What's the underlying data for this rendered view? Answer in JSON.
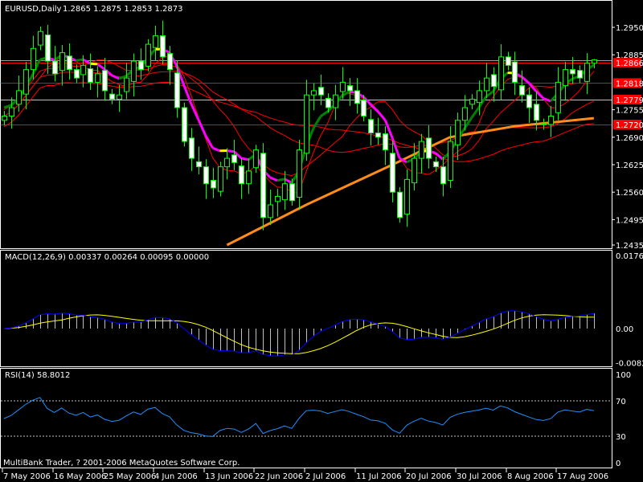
{
  "header": {
    "symbol_tf": "EURUSD,Daily",
    "ohlc": "1.2865 1.2875 1.2853 1.2873"
  },
  "macd_header": {
    "label": "MACD(12,26,9) 0.00337 0.00264 0.00095 0.00000"
  },
  "rsi_header": {
    "label": "RSI(14) 58.8012"
  },
  "copyright": "MultiBank Trader, ? 2001-2006 MetaQuotes Software Corp.",
  "colors": {
    "bull": "#00ff00",
    "bear_body": "#ffffff",
    "ma_up": "#008000",
    "ma_down": "#ff00ff",
    "ma_flat": "#ffff00",
    "ma_red": "#ff0000",
    "ma_orange": "#ff8c1a",
    "macd": "#0000ff",
    "signal": "#ffff00",
    "hist": "#c0c0c0",
    "rsi": "#1e90ff",
    "level_line": "#ff0000",
    "price_line": "#a0a0a0"
  },
  "chart_data": [
    {
      "type": "candlestick",
      "title": "EURUSD,Daily",
      "last_bar": {
        "open": 1.2865,
        "high": 1.2875,
        "low": 1.2853,
        "close": 1.2873
      },
      "ylim": [
        1.2435,
        1.296
      ],
      "y_ticks": [
        "1.2950",
        "1.2885",
        "1.2755",
        "1.2690",
        "1.2625",
        "1.2560",
        "1.2495",
        "1.2435"
      ],
      "y_tick_values": [
        1.295,
        1.2885,
        1.2755,
        1.269,
        1.2625,
        1.256,
        1.2495,
        1.2435
      ],
      "levels": [
        {
          "label": "1.2866",
          "value": 1.2866
        },
        {
          "label": "1.2818",
          "value": 1.2818
        },
        {
          "label": "1.2779",
          "value": 1.2779
        },
        {
          "label": "1.2720",
          "value": 1.272
        }
      ],
      "current_price": 1.2873,
      "close": [
        1.274,
        1.276,
        1.28,
        1.285,
        1.29,
        1.294,
        1.287,
        1.284,
        1.289,
        1.285,
        1.283,
        1.286,
        1.282,
        1.284,
        1.28,
        1.278,
        1.279,
        1.283,
        1.287,
        1.285,
        1.291,
        1.293,
        1.288,
        1.285,
        1.276,
        1.268,
        1.264,
        1.262,
        1.258,
        1.257,
        1.262,
        1.264,
        1.263,
        1.258,
        1.261,
        1.266,
        1.25,
        1.253,
        1.255,
        1.258,
        1.254,
        1.266,
        1.279,
        1.28,
        1.279,
        1.276,
        1.279,
        1.282,
        1.28,
        1.277,
        1.274,
        1.27,
        1.269,
        1.266,
        1.256,
        1.25,
        1.259,
        1.264,
        1.268,
        1.264,
        1.262,
        1.258,
        1.268,
        1.273,
        1.276,
        1.278,
        1.28,
        1.283,
        1.281,
        1.288,
        1.286,
        1.282,
        1.279,
        1.276,
        1.273,
        1.272,
        1.274,
        1.282,
        1.285,
        1.284,
        1.283,
        1.2865,
        1.2873
      ],
      "orange_ma_points": [
        [
          31,
          1.2435
        ],
        [
          42,
          1.253
        ],
        [
          54,
          1.2625
        ],
        [
          62,
          1.269
        ],
        [
          71,
          1.2716
        ],
        [
          82,
          1.2735
        ]
      ],
      "x_ticks": [
        {
          "label": "7 May 2006",
          "bar": 0
        },
        {
          "label": "16 May 2006",
          "bar": 7
        },
        {
          "label": "25 May 2006",
          "bar": 14
        },
        {
          "label": "4 Jun 2006",
          "bar": 21
        },
        {
          "label": "13 Jun 2006",
          "bar": 28
        },
        {
          "label": "22 Jun 2006",
          "bar": 35
        },
        {
          "label": "2 Jul 2006",
          "bar": 42
        },
        {
          "label": "11 Jul 2006",
          "bar": 49
        },
        {
          "label": "20 Jul 2006",
          "bar": 56
        },
        {
          "label": "30 Jul 2006",
          "bar": 63
        },
        {
          "label": "8 Aug 2006",
          "bar": 70
        },
        {
          "label": "17 Aug 2006",
          "bar": 77
        }
      ]
    },
    {
      "type": "line",
      "title": "MACD(12,26,9)",
      "values": {
        "macd": 0.00337,
        "signal": 0.00264,
        "hist": 0.00095,
        "extra": 0.0
      },
      "ylim": [
        -0.00824,
        0.01765
      ],
      "y_ticks": [
        "0.01765",
        "0.00",
        "-0.00824"
      ],
      "y_tick_values": [
        0.01765,
        0,
        -0.00824
      ]
    },
    {
      "type": "line",
      "title": "RSI(14)",
      "value": 58.8012,
      "ylim": [
        0,
        100
      ],
      "y_ticks": [
        "100",
        "70",
        "30",
        "0"
      ],
      "y_tick_values": [
        100,
        70,
        30,
        0
      ],
      "levels": [
        70,
        30
      ]
    }
  ]
}
